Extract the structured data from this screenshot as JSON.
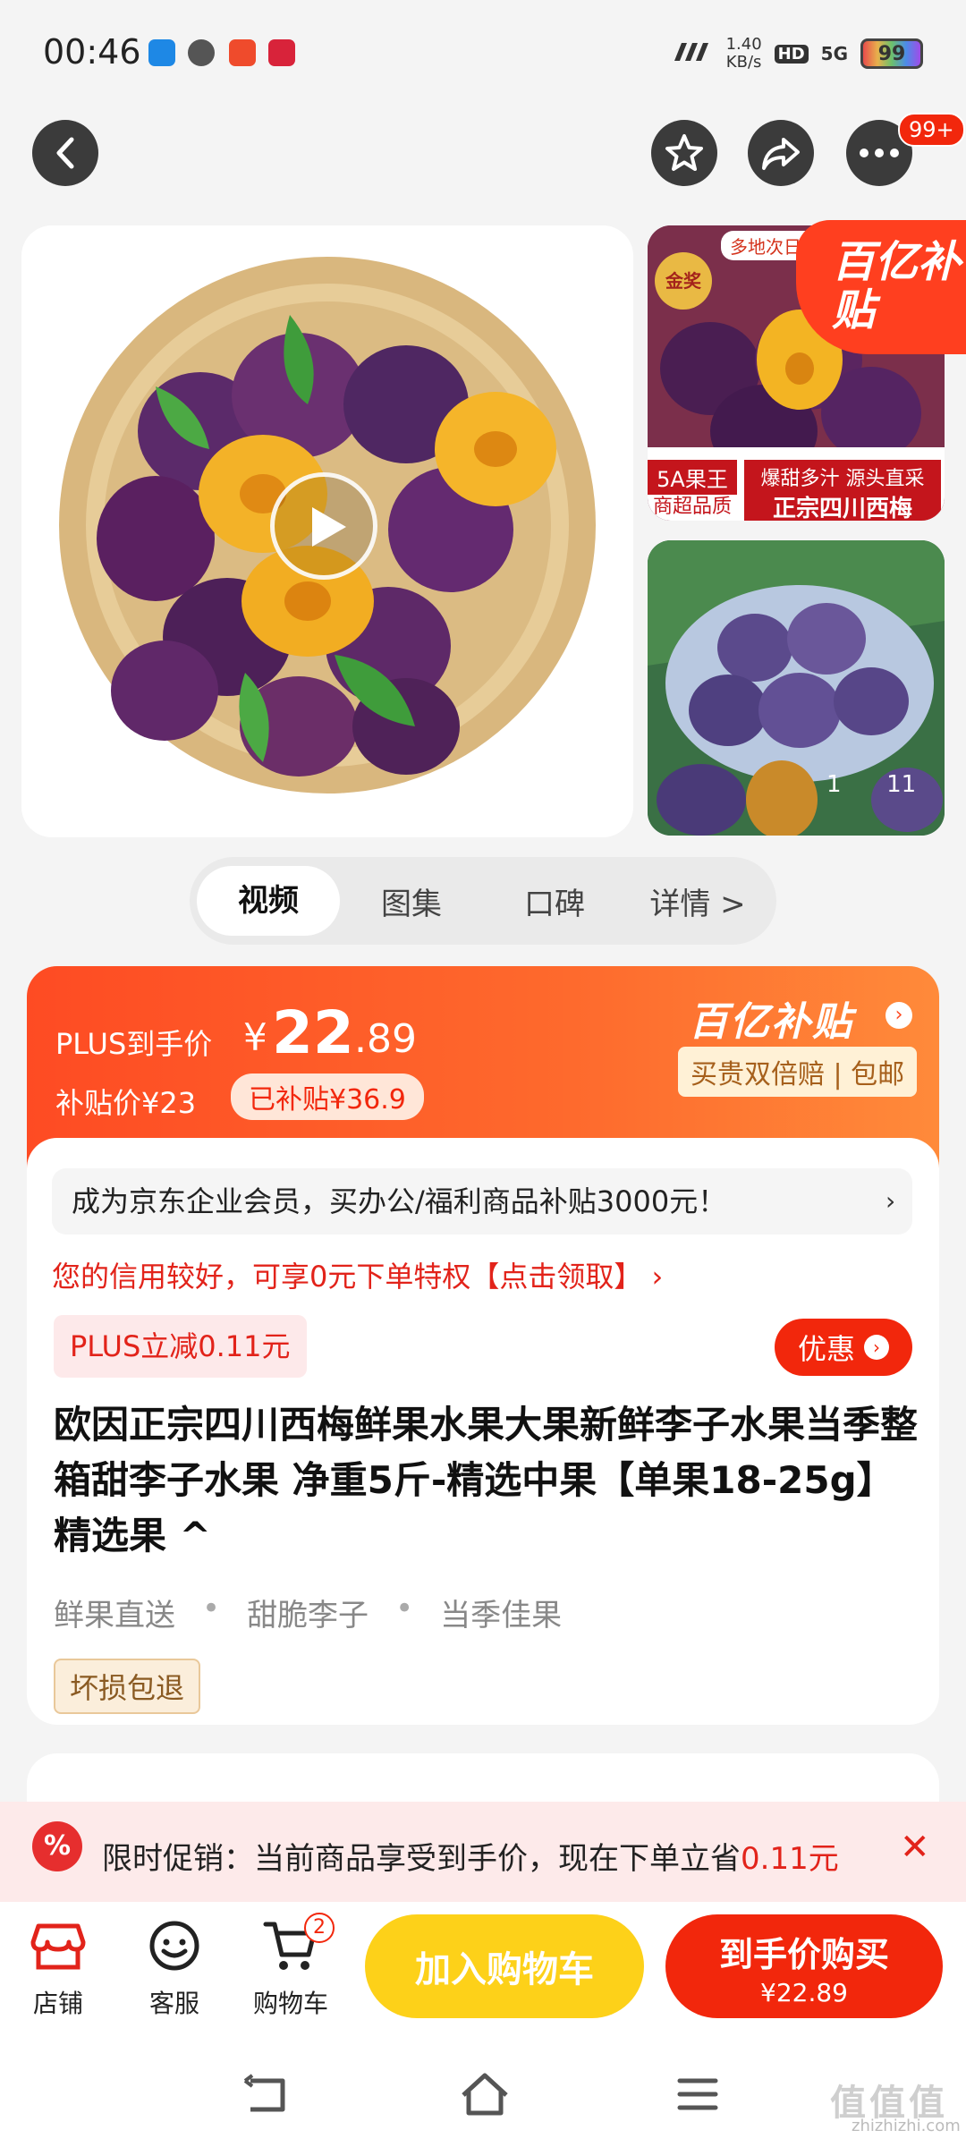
{
  "status_bar": {
    "time": "00:46",
    "net_speed_value": "1.40",
    "net_speed_unit": "KB/s",
    "hd": "HD",
    "signal": "5G",
    "battery": "99"
  },
  "top_nav": {
    "more_badge": "99+"
  },
  "gallery": {
    "side_promo": "百亿补贴",
    "side_tag_top": "多地次日达",
    "side_gold": "金奖",
    "side_line1_left": "5A果王",
    "side_line1_right": "爆甜多汁 源头直采",
    "side_line2_left": "商超品质",
    "side_line2_right": "正宗四川西梅",
    "pager_current": "1",
    "pager_total": "11"
  },
  "tabs": [
    "视频",
    "图集",
    "口碑",
    "详情 >"
  ],
  "price": {
    "plus_label": "PLUS到手价",
    "yen": "¥",
    "int": "22",
    "dec": ".89",
    "sub_price": "补贴价¥23",
    "already_subsidy": "已补贴¥36.9",
    "brand": "百亿补贴",
    "brand_arrow": "›",
    "guarantee": "买贵双倍赔 | 包邮"
  },
  "info": {
    "enterprise": "成为京东企业会员，买办公/福利商品补贴3000元！",
    "enterprise_arrow": "›",
    "credit": "您的信用较好，可享0元下单特权【点击领取】 ›",
    "plus_reduce": "PLUS立减0.11元",
    "youhui": "优惠",
    "youhui_arrow": "›",
    "title": "欧因正宗四川西梅鲜果水果大果新鲜李子水果当季整箱甜李子水果 净重5斤-精选中果【单果18-25g】 精选果 ^",
    "tags": [
      "鲜果直送",
      "甜脆李子",
      "当季佳果"
    ],
    "tag_sep": "•",
    "damage": "坏损包退"
  },
  "promo": {
    "icon": "%",
    "text_prefix": "限时促销：当前商品享受到手价，现在下单立省",
    "text_amount": "0.11元",
    "close": "✕"
  },
  "bottom_bar": {
    "store": "店铺",
    "service": "客服",
    "cart": "购物车",
    "cart_count": "2",
    "add_cart": "加入购物车",
    "buy_line1": "到手价购买",
    "buy_line2": "¥22.89"
  },
  "watermark": {
    "main": "值值值",
    "site": "zhizhizhi.com"
  },
  "colors": {
    "jd_red": "#f2270c",
    "orange": "#fe4b23",
    "yellow": "#fdd119"
  }
}
